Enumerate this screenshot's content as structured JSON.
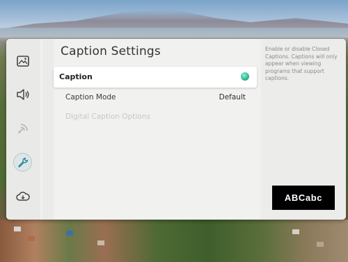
{
  "sidebar": {
    "icons": [
      {
        "name": "picture-icon"
      },
      {
        "name": "sound-icon"
      },
      {
        "name": "broadcasting-icon"
      },
      {
        "name": "wrench-icon",
        "selected": true
      },
      {
        "name": "cloud-icon"
      }
    ]
  },
  "settings": {
    "title": "Caption Settings",
    "caption": {
      "label": "Caption",
      "enabled": true
    },
    "caption_mode": {
      "label": "Caption Mode",
      "value": "Default"
    },
    "digital_caption_options": {
      "label": "Digital Caption Options",
      "enabled": false
    }
  },
  "help": {
    "text": "Enable or disable Closed Captions. Captions will only appear when viewing programs that support captions.",
    "preview": "ABCabc"
  },
  "colors": {
    "toggle_on": "#2ab791"
  }
}
